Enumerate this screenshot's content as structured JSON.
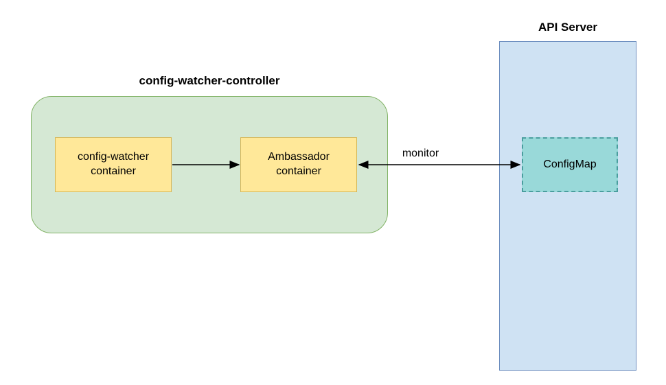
{
  "diagram": {
    "controller_group_title": "config-watcher-controller",
    "config_watcher_box": "config-watcher\ncontainer",
    "ambassador_box": "Ambassador\ncontainer",
    "api_server_title": "API Server",
    "configmap_box": "ConfigMap",
    "edge_monitor_label": "monitor"
  }
}
